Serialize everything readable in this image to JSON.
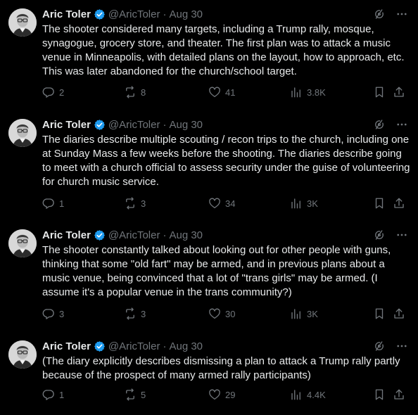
{
  "author": {
    "name": "Aric Toler",
    "handle": "@AricToler",
    "separator": "·"
  },
  "posts": [
    {
      "date": "Aug 30",
      "text": "The shooter considered many targets, including a Trump rally, mosque, synagogue, grocery store, and theater. The first plan was to attack a music venue in Minneapolis, with detailed plans on the layout, how to approach, etc. This was later abandoned for the church/school target.",
      "replies": "2",
      "reposts": "8",
      "likes": "41",
      "views": "3.8K"
    },
    {
      "date": "Aug 30",
      "text": "The diaries describe multiple scouting / recon trips to the church, including one at Sunday Mass a few weeks before the shooting. The diaries describe going to meet with a church official to assess security under the guise of volunteering for church music service.",
      "replies": "1",
      "reposts": "3",
      "likes": "34",
      "views": "3K"
    },
    {
      "date": "Aug 30",
      "text": "The shooter constantly talked about looking out for other people with guns, thinking that some \"old fart\" may be armed, and in previous plans about a music venue, being convinced that a lot of \"trans girls\" may be armed. (I assume it's a popular venue in the trans community?)",
      "replies": "3",
      "reposts": "3",
      "likes": "30",
      "views": "3K"
    },
    {
      "date": "Aug 30",
      "text": "(The diary explicitly describes dismissing a plan to attack a Trump rally partly because of the prospect of many armed rally participants)",
      "replies": "1",
      "reposts": "5",
      "likes": "29",
      "views": "4.4K"
    }
  ],
  "icons": {
    "verified": "verified-badge-icon",
    "grok": "grok-icon",
    "more": "more-icon",
    "reply": "reply-icon",
    "repost": "repost-icon",
    "like": "like-icon",
    "views": "views-icon",
    "bookmark": "bookmark-icon",
    "share": "share-icon"
  },
  "colors": {
    "background": "#000000",
    "text": "#e7e9ea",
    "muted": "#71767b",
    "verified": "#1d9bf0"
  }
}
